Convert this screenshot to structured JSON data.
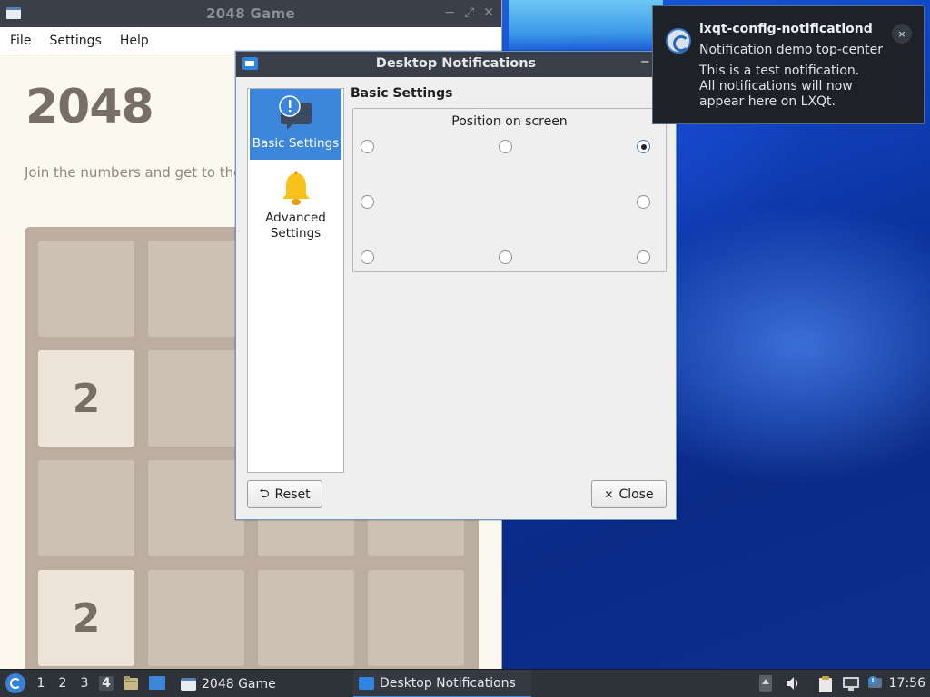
{
  "game_window": {
    "title": "2048 Game",
    "menu": [
      "File",
      "Settings",
      "Help"
    ],
    "heading": "2048",
    "subtext": "Join the numbers and get to the",
    "tiles": [
      "",
      "",
      "",
      "",
      "2",
      "",
      "",
      "",
      "",
      "",
      "",
      "",
      "2",
      "",
      "",
      ""
    ]
  },
  "dialog": {
    "title": "Desktop Notifications",
    "sidebar": [
      {
        "label": "Basic Settings",
        "icon": "notification-bubble-icon",
        "selected": true
      },
      {
        "label": "Advanced Settings",
        "icon": "bell-icon",
        "selected": false
      }
    ],
    "section_title": "Basic Settings",
    "position_group": {
      "title": "Position on screen",
      "selected": "top-right",
      "options": [
        "top-left",
        "top-center",
        "top-right",
        "center-left",
        "center-right",
        "bottom-left",
        "bottom-center",
        "bottom-right"
      ]
    },
    "reset_label": "Reset",
    "close_label": "Close"
  },
  "notification": {
    "app": "lxqt-config-notificationd",
    "summary": "Notification demo top-center",
    "body_lines": [
      "This is a test notification.",
      "All notifications will now",
      "appear here on LXQt."
    ],
    "close_glyph": "×"
  },
  "taskbar": {
    "desktops": [
      "1",
      "2",
      "3",
      "4"
    ],
    "active_desktop": "4",
    "tasks": [
      {
        "label": "2048 Game",
        "active": false
      },
      {
        "label": "Desktop Notifications",
        "active": true
      }
    ],
    "clock": "17:56"
  },
  "colors": {
    "accent": "#3c87dc",
    "titlebar": "#3b3f4a",
    "taskbar": "#2e3239",
    "tile_empty": "#cdc1b4",
    "tile_2": "#eee4da",
    "board": "#bbada0"
  }
}
